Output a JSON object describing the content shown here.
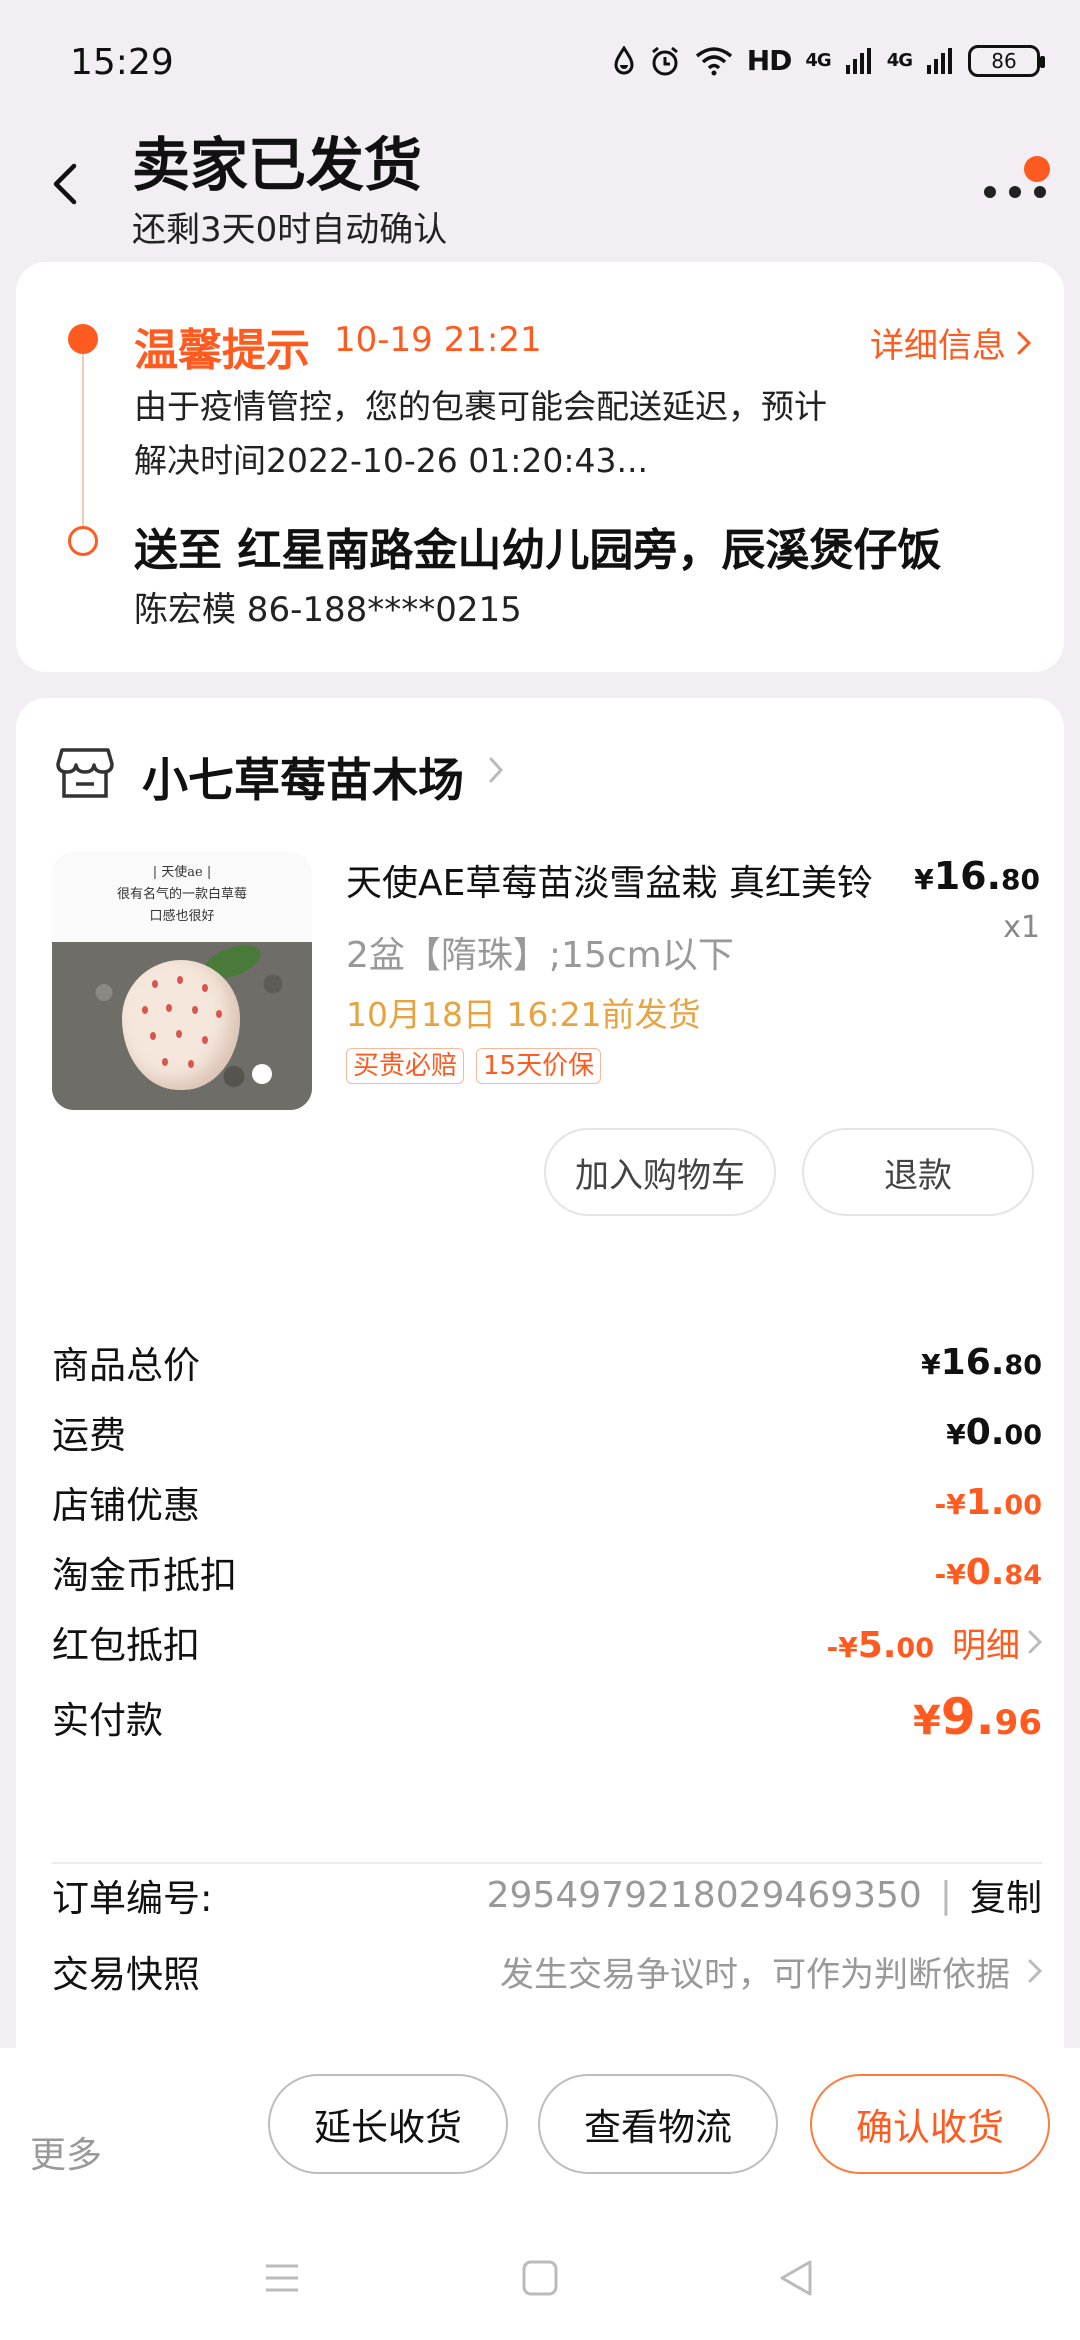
{
  "status_bar": {
    "time": "15:29",
    "network_hd": "HD",
    "network_4g_1": "4G",
    "network_4g_2": "4G",
    "battery": "86"
  },
  "header": {
    "title": "卖家已发货",
    "subtitle": "还剩3天0时自动确认"
  },
  "logistics": {
    "tip_title": "温馨提示",
    "tip_time": "10-19 21:21",
    "detail_link": "详细信息",
    "tip_text": "由于疫情管控，您的包裹可能会配送延迟，预计解决时间2022-10-26 01:20:43...",
    "address": "送至 红星南路金山幼儿园旁，辰溪煲仔饭",
    "contact": "陈宏模 86-188****0215"
  },
  "store": {
    "name": "小七草莓苗木场"
  },
  "product": {
    "image_caption_1": "| 天使ae |",
    "image_caption_2": "很有名气的一款白草莓",
    "image_caption_3": "口感也很好",
    "title": "天使AE草莓苗淡雪盆栽  真红美铃",
    "price_yen": "¥",
    "price_int": "16.",
    "price_dec": "80",
    "qty": "x1",
    "spec": "2盆【隋珠】;15cm以下",
    "ship_time": "10月18日 16:21前发货",
    "tags": [
      "买贵必赔",
      "15天价保"
    ],
    "btn_cart": "加入购物车",
    "btn_refund": "退款"
  },
  "summary": {
    "rows": [
      {
        "label": "商品总价",
        "prefix": "",
        "yen": "¥",
        "int": "16.",
        "dec": "80"
      },
      {
        "label": "运费",
        "prefix": "",
        "yen": "¥",
        "int": "0.",
        "dec": "00"
      },
      {
        "label": "店铺优惠",
        "prefix": "-",
        "yen": "¥",
        "int": "1.",
        "dec": "00"
      },
      {
        "label": "淘金币抵扣",
        "prefix": "-",
        "yen": "¥",
        "int": "0.",
        "dec": "84"
      },
      {
        "label": "红包抵扣",
        "prefix": "-",
        "yen": "¥",
        "int": "5.",
        "dec": "00",
        "link": "明细"
      },
      {
        "label": "实付款",
        "prefix": "",
        "yen": "¥",
        "int": "9.",
        "dec": "96"
      }
    ],
    "order_no_label": "订单编号:",
    "order_no": "2954979218029469350",
    "copy": "复制",
    "snapshot_label": "交易快照",
    "snapshot_hint": "发生交易争议时，可作为判断依据"
  },
  "bottom": {
    "more": "更多",
    "extend": "延长收货",
    "logistics": "查看物流",
    "confirm": "确认收货"
  },
  "colors": {
    "accent": "#ff5a1f",
    "ship_time": "#e8a341",
    "background": "#f3eef3"
  }
}
